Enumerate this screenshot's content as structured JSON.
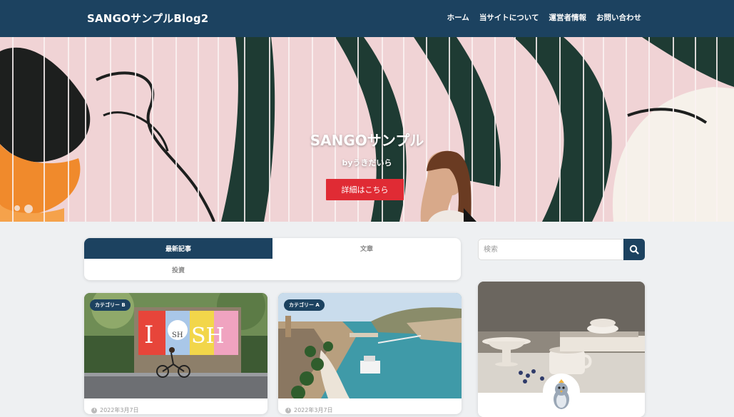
{
  "header": {
    "site_title": "SANGOサンプルBlog2",
    "nav": [
      "ホーム",
      "当サイトについて",
      "運営者情報",
      "お問い合わせ"
    ]
  },
  "hero": {
    "title": "SANGOサンプル",
    "byline": "byうきだいら",
    "button_label": "詳細はこちら"
  },
  "tabs": {
    "items": [
      "最新記事",
      "文章",
      "投資"
    ],
    "active": "最新記事"
  },
  "cards": [
    {
      "category": "カテゴリー B",
      "date": "2022年3月7日",
      "sign_text": "I SH",
      "sign_heart": "SH"
    },
    {
      "category": "カテゴリー A",
      "date": "2022年3月7日"
    }
  ],
  "sidebar": {
    "search_placeholder": "検索"
  },
  "colors": {
    "header_bg": "#1c4260",
    "accent_button": "#e02b34",
    "hero_bg": "#f0d3d5"
  }
}
